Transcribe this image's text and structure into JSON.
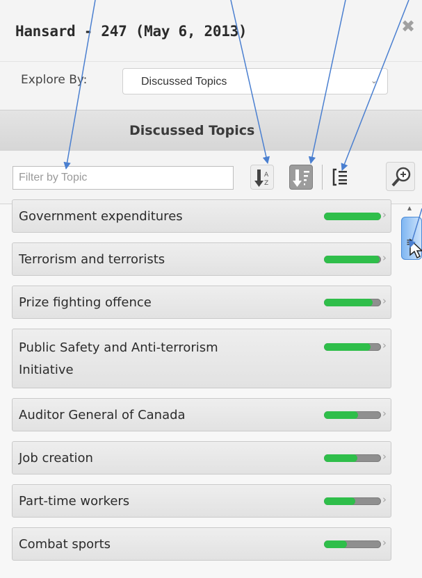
{
  "window": {
    "title": "Hansard - 247 (May 6, 2013)",
    "close_glyph": "✖"
  },
  "explore": {
    "label": "Explore By:",
    "selected": "Discussed Topics"
  },
  "section": {
    "title": "Discussed Topics"
  },
  "toolbar": {
    "filter_placeholder": "Filter by Topic",
    "buttons": [
      "sort-alpha-icon",
      "sort-frequency-icon",
      "tree-view-icon",
      "zoom-in-icon"
    ]
  },
  "topics": [
    {
      "label_lines": [
        "Government expenditures"
      ],
      "frequency": 1.0
    },
    {
      "label_lines": [
        "Terrorism and terrorists"
      ],
      "frequency": 0.98
    },
    {
      "label_lines": [
        "Prize fighting offence"
      ],
      "frequency": 0.85
    },
    {
      "label_lines": [
        "Public Safety and Anti-terrorism",
        "Initiative"
      ],
      "frequency": 0.82
    },
    {
      "label_lines": [
        "Auditor General of Canada"
      ],
      "frequency": 0.6
    },
    {
      "label_lines": [
        "Job creation"
      ],
      "frequency": 0.58
    },
    {
      "label_lines": [
        "Part-time workers"
      ],
      "frequency": 0.55
    },
    {
      "label_lines": [
        "Combat sports"
      ],
      "frequency": 0.4
    }
  ],
  "colors": {
    "meter_fill": "#2fbe4a",
    "meter_track": "#8f8f8f",
    "annotation_arrow": "#4a7fd0",
    "scroll_thumb": "#7fb6f2"
  }
}
